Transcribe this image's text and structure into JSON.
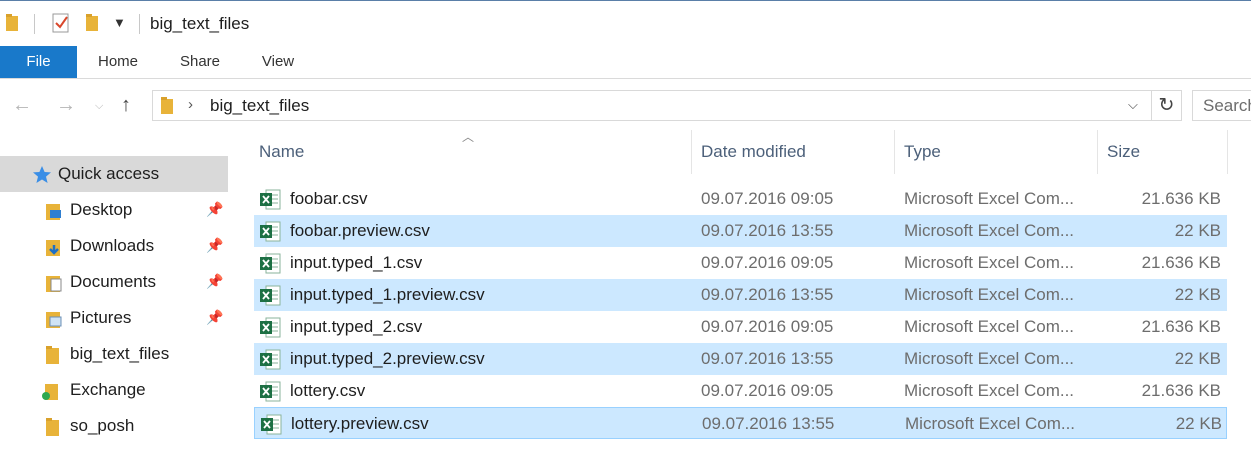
{
  "window": {
    "title": "big_text_files"
  },
  "ribbon": {
    "tabs": [
      "File",
      "Home",
      "Share",
      "View"
    ]
  },
  "address": {
    "breadcrumb": "big_text_files",
    "search_placeholder": "Search"
  },
  "sidebar": {
    "items": [
      {
        "label": "Quick access",
        "pinned": false
      },
      {
        "label": "Desktop",
        "pinned": true
      },
      {
        "label": "Downloads",
        "pinned": true
      },
      {
        "label": "Documents",
        "pinned": true
      },
      {
        "label": "Pictures",
        "pinned": true
      },
      {
        "label": "big_text_files",
        "pinned": false
      },
      {
        "label": "Exchange",
        "pinned": false
      },
      {
        "label": "so_posh",
        "pinned": false
      }
    ]
  },
  "columns": {
    "name": "Name",
    "date": "Date modified",
    "type": "Type",
    "size": "Size"
  },
  "files": [
    {
      "name": "foobar.csv",
      "date": "09.07.2016 09:05",
      "type": "Microsoft Excel Com...",
      "size": "21.636 KB"
    },
    {
      "name": "foobar.preview.csv",
      "date": "09.07.2016 13:55",
      "type": "Microsoft Excel Com...",
      "size": "22 KB"
    },
    {
      "name": "input.typed_1.csv",
      "date": "09.07.2016 09:05",
      "type": "Microsoft Excel Com...",
      "size": "21.636 KB"
    },
    {
      "name": "input.typed_1.preview.csv",
      "date": "09.07.2016 13:55",
      "type": "Microsoft Excel Com...",
      "size": "22 KB"
    },
    {
      "name": "input.typed_2.csv",
      "date": "09.07.2016 09:05",
      "type": "Microsoft Excel Com...",
      "size": "21.636 KB"
    },
    {
      "name": "input.typed_2.preview.csv",
      "date": "09.07.2016 13:55",
      "type": "Microsoft Excel Com...",
      "size": "22 KB"
    },
    {
      "name": "lottery.csv",
      "date": "09.07.2016 09:05",
      "type": "Microsoft Excel Com...",
      "size": "21.636 KB"
    },
    {
      "name": "lottery.preview.csv",
      "date": "09.07.2016 13:55",
      "type": "Microsoft Excel Com...",
      "size": "22 KB"
    }
  ],
  "colors": {
    "accent": "#1979ca",
    "selection": "#cce8ff",
    "selection_border": "#99d1ff",
    "excel_green": "#1d7044"
  }
}
